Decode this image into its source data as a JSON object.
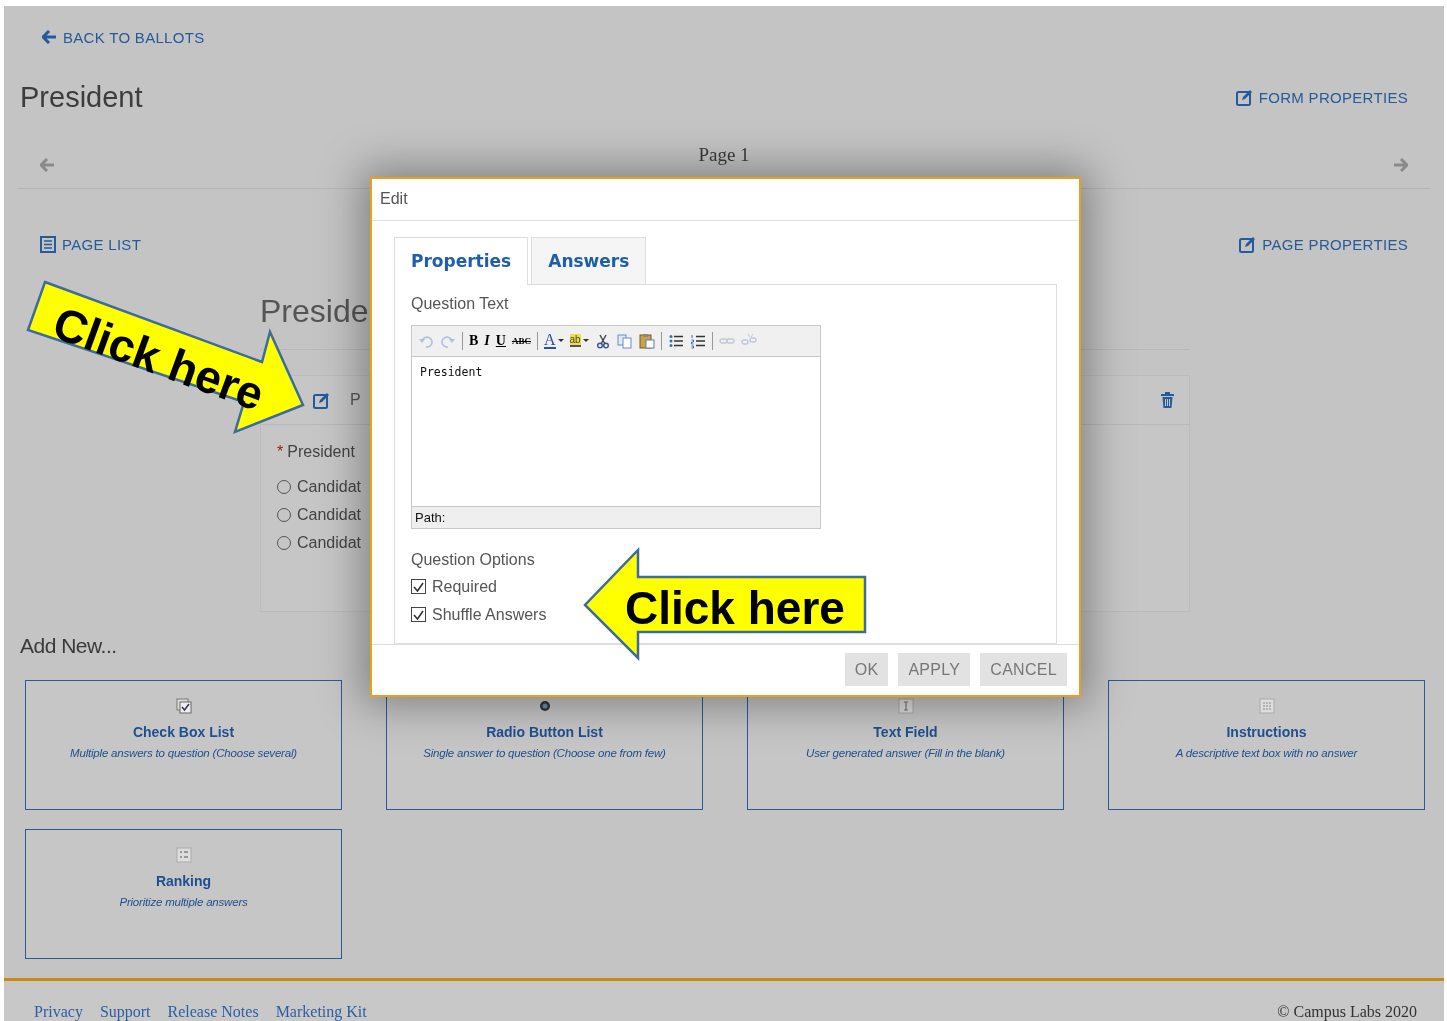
{
  "back_link": "BACK TO BALLOTS",
  "title": "President",
  "form_properties": "FORM PROPERTIES",
  "pager": {
    "label": "Page 1"
  },
  "page_list": "PAGE LIST",
  "page_properties": "PAGE PROPERTIES",
  "page_heading": "Preside",
  "question": {
    "header": "P",
    "required_mark": "*",
    "label": "President",
    "options": [
      {
        "label": "Candidat",
        "selected": false
      },
      {
        "label": "Candidat",
        "selected": false
      },
      {
        "label": "Candidat",
        "selected": false
      }
    ]
  },
  "add_new": {
    "title": "Add New...",
    "items": [
      {
        "kind": "checkbox",
        "title": "Check Box List",
        "description": "Multiple answers to question (Choose several)"
      },
      {
        "kind": "radio",
        "title": "Radio Button List",
        "description": "Single answer to question (Choose one from few)"
      },
      {
        "kind": "text",
        "title": "Text Field",
        "description": "User generated answer (Fill in the blank)"
      },
      {
        "kind": "instructions",
        "title": "Instructions",
        "description": "A descriptive text box with no answer"
      },
      {
        "kind": "ranking",
        "title": "Ranking",
        "description": "Prioritize multiple answers"
      }
    ]
  },
  "footer": {
    "links": [
      "Privacy",
      "Support",
      "Release Notes",
      "Marketing Kit"
    ],
    "copyright": "© Campus Labs 2020"
  },
  "dialog": {
    "title": "Edit",
    "tabs": [
      {
        "label": "Properties",
        "selected": true
      },
      {
        "label": "Answers",
        "selected": false
      }
    ],
    "question_text_label": "Question Text",
    "editor": {
      "toolbar": [
        {
          "kind": "undo",
          "disabled": true
        },
        {
          "kind": "redo",
          "disabled": true
        },
        {
          "kind": "separator"
        },
        {
          "kind": "bold",
          "label": "B",
          "disabled": false
        },
        {
          "kind": "italic",
          "label": "I",
          "disabled": false
        },
        {
          "kind": "underline",
          "label": "U",
          "disabled": false
        },
        {
          "kind": "strike",
          "label": "ABC",
          "disabled": false
        },
        {
          "kind": "separator"
        },
        {
          "kind": "font-color",
          "label": "A",
          "disabled": false
        },
        {
          "kind": "highlight",
          "label": "ab",
          "disabled": false
        },
        {
          "kind": "cut",
          "disabled": false
        },
        {
          "kind": "copy",
          "disabled": false
        },
        {
          "kind": "paste",
          "disabled": false
        },
        {
          "kind": "separator"
        },
        {
          "kind": "bullets",
          "disabled": false
        },
        {
          "kind": "numbers",
          "disabled": false
        },
        {
          "kind": "separator"
        },
        {
          "kind": "link",
          "disabled": true
        },
        {
          "kind": "unlink",
          "disabled": true
        }
      ],
      "content": "President",
      "path": "Path:"
    },
    "options_label": "Question Options",
    "options": [
      {
        "label": "Required",
        "checked": true
      },
      {
        "label": "Shuffle Answers",
        "checked": true
      }
    ],
    "buttons": [
      "OK",
      "APPLY",
      "CANCEL"
    ]
  },
  "callouts": [
    {
      "kind": "arrow-down-right",
      "text": "Click here"
    },
    {
      "kind": "arrow-left",
      "text": "Click here"
    }
  ]
}
